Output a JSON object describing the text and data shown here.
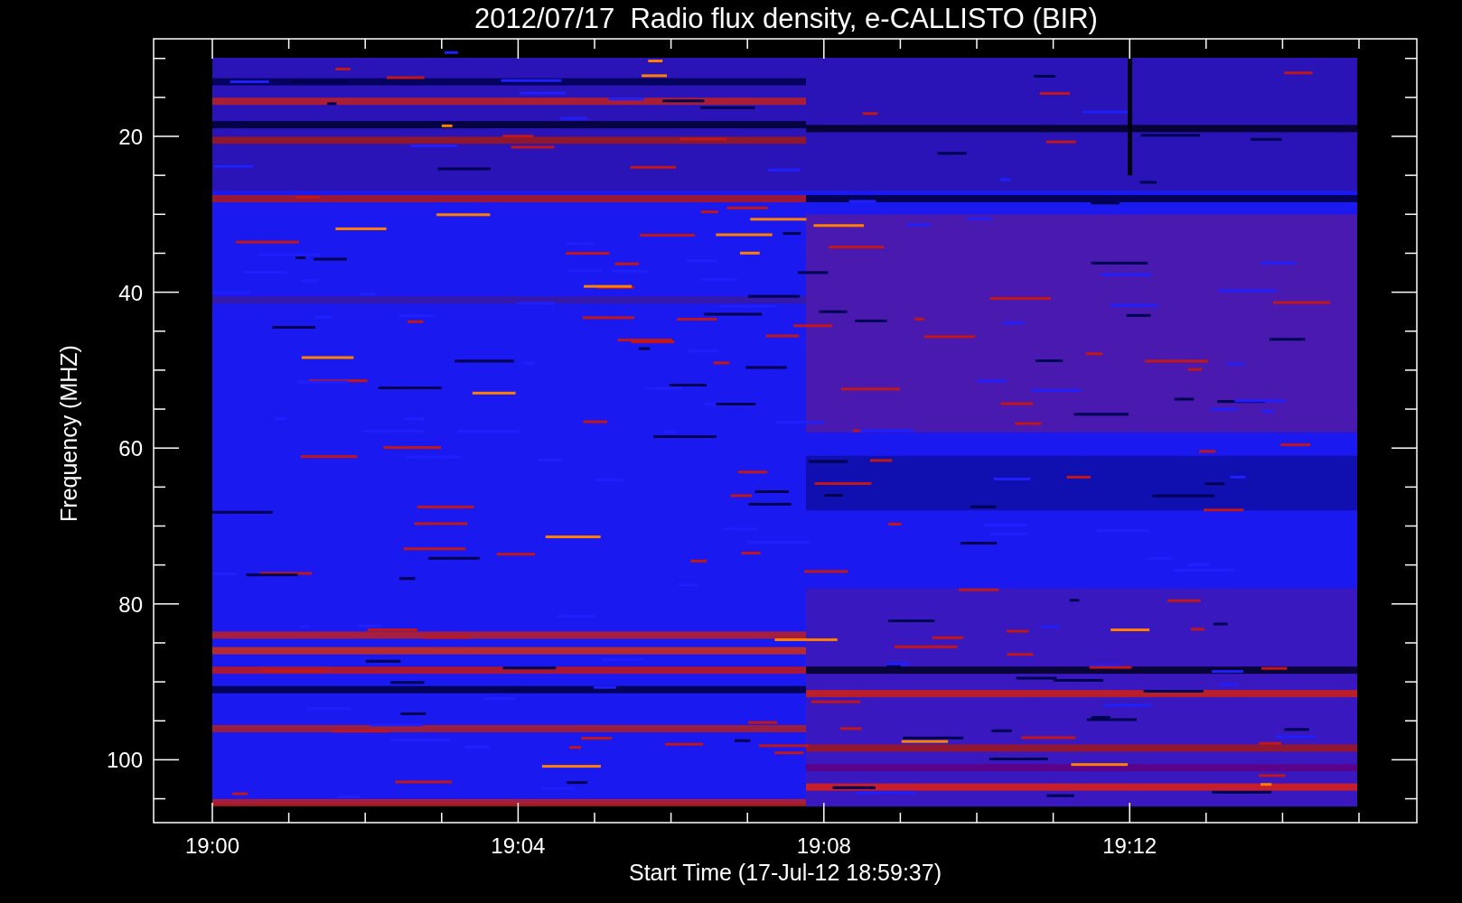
{
  "title": "2012/07/17  Radio flux density, e-CALLISTO (BIR)",
  "y_axis": {
    "label": "Frequency (MHZ)",
    "ticks": [
      "20",
      "40",
      "60",
      "80",
      "100"
    ]
  },
  "x_axis": {
    "label": "Start Time (17-Jul-12 18:59:37)",
    "ticks": [
      "19:00",
      "19:04",
      "19:08",
      "19:12"
    ]
  }
}
